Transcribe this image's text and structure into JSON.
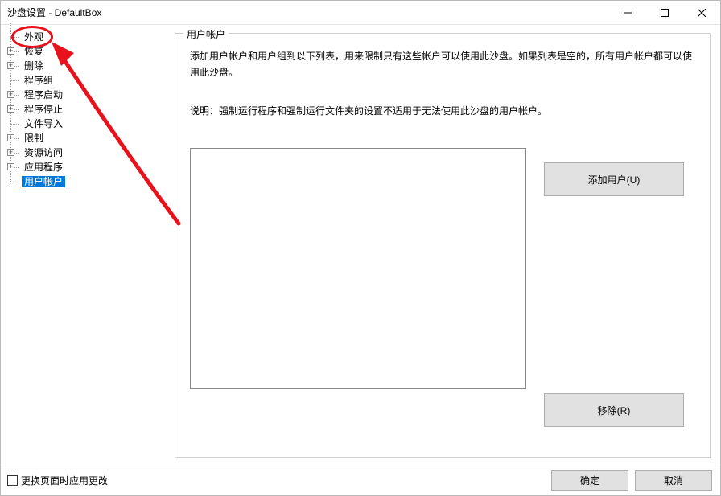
{
  "window": {
    "title": "沙盘设置 - DefaultBox"
  },
  "tree": {
    "items": [
      {
        "label": "外观",
        "expandable": false
      },
      {
        "label": "恢复",
        "expandable": true
      },
      {
        "label": "删除",
        "expandable": true
      },
      {
        "label": "程序组",
        "expandable": false
      },
      {
        "label": "程序启动",
        "expandable": true
      },
      {
        "label": "程序停止",
        "expandable": true
      },
      {
        "label": "文件导入",
        "expandable": false
      },
      {
        "label": "限制",
        "expandable": true
      },
      {
        "label": "资源访问",
        "expandable": true
      },
      {
        "label": "应用程序",
        "expandable": true
      },
      {
        "label": "用户帐户",
        "expandable": false,
        "selected": true
      }
    ]
  },
  "panel": {
    "legend": "用户帐户",
    "desc": "添加用户帐户和用户组到以下列表，用来限制只有这些帐户可以使用此沙盘。如果列表是空的，所有用户帐户都可以使用此沙盘。",
    "note": "说明：强制运行程序和强制运行文件夹的设置不适用于无法使用此沙盘的用户帐户。",
    "add_user_label": "添加用户(U)",
    "remove_label": "移除(R)"
  },
  "footer": {
    "apply_on_page_change_label": "更换页面时应用更改",
    "ok_label": "确定",
    "cancel_label": "取消"
  }
}
